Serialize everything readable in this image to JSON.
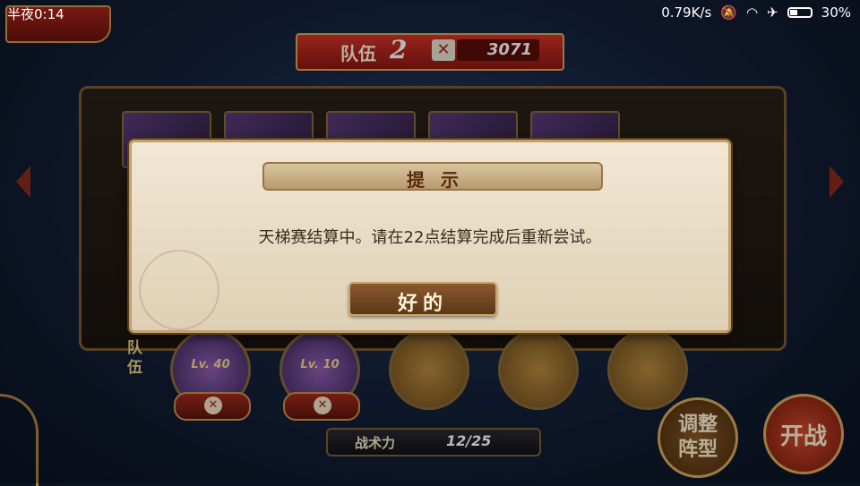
{
  "status_bar": {
    "time": "半夜0:14",
    "net_speed": "0.79K/s",
    "battery": "30%"
  },
  "team": {
    "label": "队伍",
    "number": "2",
    "power_icon": "crossed-swords-icon",
    "power": "3071"
  },
  "formation": {
    "side_label": "队伍",
    "slots": [
      {
        "level": "Lv. 40"
      },
      {
        "level": "Lv. 10"
      }
    ]
  },
  "tactics": {
    "label": "战术力",
    "value": "12/25"
  },
  "buttons": {
    "adjust": "调整\n阵型",
    "fight": "开战"
  },
  "dialog": {
    "title": "提示",
    "message": "天梯赛结算中。请在22点结算完成后重新尝试。",
    "ok": "好的"
  },
  "colors": {
    "banner_red": "#d2332a",
    "gold_border": "#d8a85b",
    "dialog_bg": "#f1e7d4"
  }
}
